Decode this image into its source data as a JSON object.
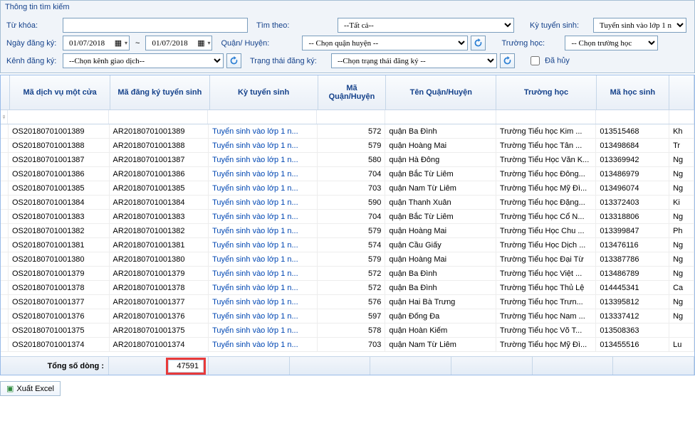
{
  "panel": {
    "title": "Thông tin tìm kiếm"
  },
  "filters": {
    "keyword_label": "Từ khóa:",
    "keyword_value": "",
    "search_by_label": "Tìm theo:",
    "search_by_value": "--Tất cả--",
    "session_label": "Kỳ tuyển sinh:",
    "session_value": "Tuyển sinh vào lớp 1 n",
    "reg_date_label": "Ngày đăng ký:",
    "date_from": "01/07/2018",
    "date_to": "01/07/2018",
    "date_sep": "~",
    "district_label": "Quận/ Huyện:",
    "district_value": "-- Chọn quận huyện --",
    "school_label": "Trường học:",
    "school_value": "-- Chọn trường học",
    "channel_label": "Kênh đăng ký:",
    "channel_value": "--Chọn kênh giao dịch--",
    "status_label": "Trạng thái đăng ký:",
    "status_value": "--Chọn trạng thái đăng ký --",
    "cancelled_label": "Đã hủy"
  },
  "grid": {
    "headers": {
      "c1": "Mã dịch vụ một cửa",
      "c2": "Mã đăng ký tuyển sinh",
      "c3": "Kỳ tuyển sinh",
      "c4": "Mã Quận/Huyện",
      "c5": "Tên Quận/Huyện",
      "c6": "Trường học",
      "c7": "Mã học sinh",
      "c8": ""
    },
    "rows": [
      {
        "c1": "OS20180701001389",
        "c2": "AR20180701001389",
        "c3": "Tuyển sinh vào lớp 1 n...",
        "c4": "572",
        "c5": "quận Ba Đình",
        "c6": "Trường Tiểu học Kim ...",
        "c7": "013515468",
        "c8": "Kh"
      },
      {
        "c1": "OS20180701001388",
        "c2": "AR20180701001388",
        "c3": "Tuyển sinh vào lớp 1 n...",
        "c4": "579",
        "c5": "quận Hoàng Mai",
        "c6": "Trường Tiểu học Tân ...",
        "c7": "013498684",
        "c8": "Tr"
      },
      {
        "c1": "OS20180701001387",
        "c2": "AR20180701001387",
        "c3": "Tuyển sinh vào lớp 1 n...",
        "c4": "580",
        "c5": "quận Hà Đông",
        "c6": "Trường Tiểu Học Văn K...",
        "c7": "013369942",
        "c8": "Ng"
      },
      {
        "c1": "OS20180701001386",
        "c2": "AR20180701001386",
        "c3": "Tuyển sinh vào lớp 1 n...",
        "c4": "704",
        "c5": "quận Bắc Từ Liêm",
        "c6": "Trường Tiểu học Đông...",
        "c7": "013486979",
        "c8": "Ng"
      },
      {
        "c1": "OS20180701001385",
        "c2": "AR20180701001385",
        "c3": "Tuyển sinh vào lớp 1 n...",
        "c4": "703",
        "c5": "quận Nam Từ Liêm",
        "c6": "Trường Tiểu học Mỹ Đì...",
        "c7": "013496074",
        "c8": "Ng"
      },
      {
        "c1": "OS20180701001384",
        "c2": "AR20180701001384",
        "c3": "Tuyển sinh vào lớp 1 n...",
        "c4": "590",
        "c5": "quận Thanh Xuân",
        "c6": "Trường Tiểu học Đặng...",
        "c7": "013372403",
        "c8": "Ki"
      },
      {
        "c1": "OS20180701001383",
        "c2": "AR20180701001383",
        "c3": "Tuyển sinh vào lớp 1 n...",
        "c4": "704",
        "c5": "quận Bắc Từ Liêm",
        "c6": "Trường Tiểu học Cổ N...",
        "c7": "013318806",
        "c8": "Ng"
      },
      {
        "c1": "OS20180701001382",
        "c2": "AR20180701001382",
        "c3": "Tuyển sinh vào lớp 1 n...",
        "c4": "579",
        "c5": "quận Hoàng Mai",
        "c6": "Trường Tiểu Học Chu ...",
        "c7": "013399847",
        "c8": "Ph"
      },
      {
        "c1": "OS20180701001381",
        "c2": "AR20180701001381",
        "c3": "Tuyển sinh vào lớp 1 n...",
        "c4": "574",
        "c5": "quận Cầu Giấy",
        "c6": "Trường Tiểu Học Dịch ...",
        "c7": "013476116",
        "c8": "Ng"
      },
      {
        "c1": "OS20180701001380",
        "c2": "AR20180701001380",
        "c3": "Tuyển sinh vào lớp 1 n...",
        "c4": "579",
        "c5": "quận Hoàng Mai",
        "c6": "Trường Tiểu học Đại Từ",
        "c7": "013387786",
        "c8": "Ng"
      },
      {
        "c1": "OS20180701001379",
        "c2": "AR20180701001379",
        "c3": "Tuyển sinh vào lớp 1 n...",
        "c4": "572",
        "c5": "quận Ba Đình",
        "c6": "Trường Tiểu học Việt ...",
        "c7": "013486789",
        "c8": "Ng"
      },
      {
        "c1": "OS20180701001378",
        "c2": "AR20180701001378",
        "c3": "Tuyển sinh vào lớp 1 n...",
        "c4": "572",
        "c5": "quận Ba Đình",
        "c6": "Trường Tiểu học Thủ Lệ",
        "c7": "014445341",
        "c8": "Ca"
      },
      {
        "c1": "OS20180701001377",
        "c2": "AR20180701001377",
        "c3": "Tuyển sinh vào lớp 1 n...",
        "c4": "576",
        "c5": "quận Hai Bà Trưng",
        "c6": "Trường Tiểu học Trưn...",
        "c7": "013395812",
        "c8": "Ng"
      },
      {
        "c1": "OS20180701001376",
        "c2": "AR20180701001376",
        "c3": "Tuyển sinh vào lớp 1 n...",
        "c4": "597",
        "c5": "quận Đống Đa",
        "c6": "Trường Tiểu học Nam ...",
        "c7": "013337412",
        "c8": "Ng"
      },
      {
        "c1": "OS20180701001375",
        "c2": "AR20180701001375",
        "c3": "Tuyển sinh vào lớp 1 n...",
        "c4": "578",
        "c5": "quận Hoàn Kiếm",
        "c6": "Trường Tiểu học Võ T...",
        "c7": "013508363",
        "c8": ""
      },
      {
        "c1": "OS20180701001374",
        "c2": "AR20180701001374",
        "c3": "Tuyển sinh vào lớp 1 n...",
        "c4": "703",
        "c5": "quận Nam Từ Liêm",
        "c6": "Trường Tiểu học Mỹ Đì...",
        "c7": "013455516",
        "c8": "Lu"
      }
    ],
    "footer": {
      "label": "Tổng số dòng :",
      "value": "47591"
    }
  },
  "export": {
    "label": "Xuất Excel"
  },
  "icons": {
    "refresh": "↻",
    "calendar": "▦",
    "dd": "▾",
    "filter": "⌕",
    "excel": "▣"
  }
}
